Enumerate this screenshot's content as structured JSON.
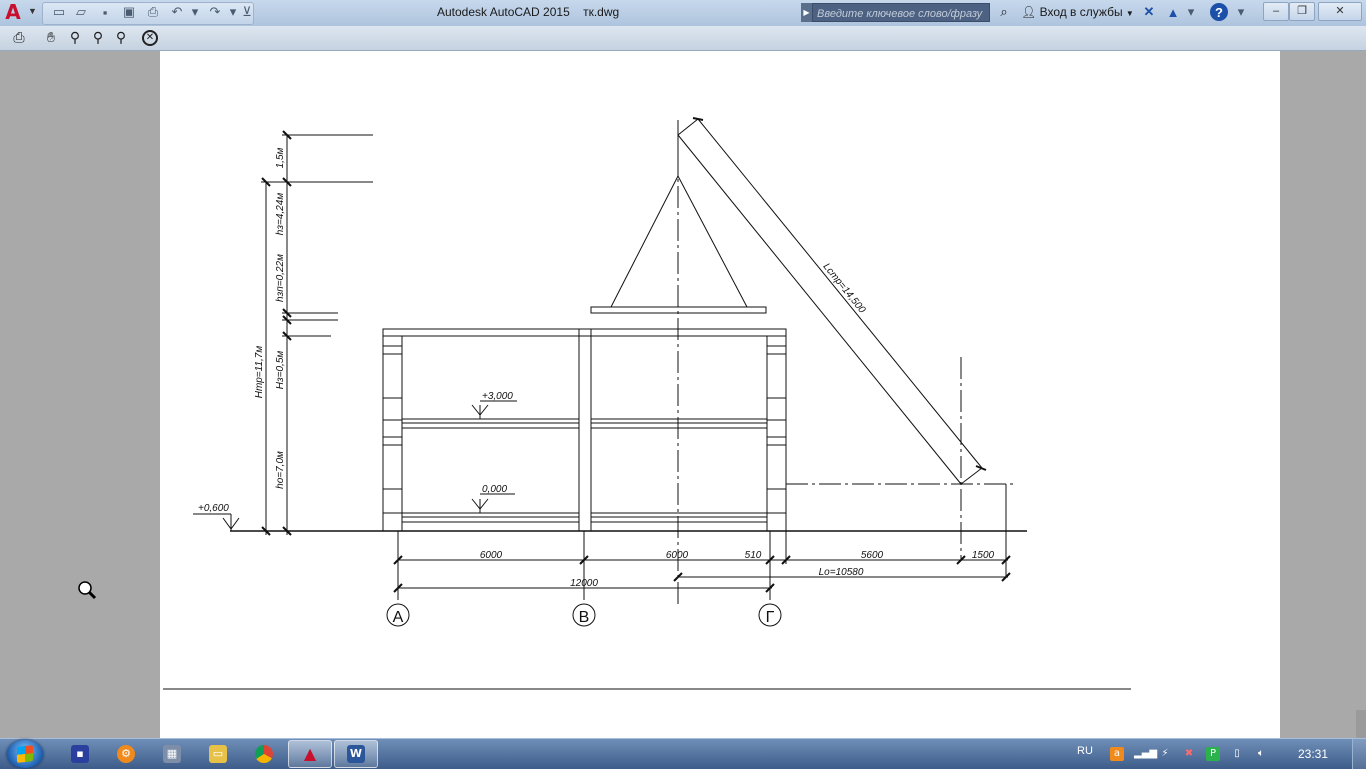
{
  "window": {
    "title": "Autodesk AutoCAD 2015    тк.dwg",
    "search_placeholder": "Введите ключевое слово/фразу",
    "login_label": "Вход в службы",
    "help_label": "?"
  },
  "quick_access": [
    "new-icon",
    "open-icon",
    "save-icon",
    "saveas-icon",
    "print-icon",
    "undo-icon",
    "redo-icon",
    "customize-icon"
  ],
  "preview_toolbar": [
    "print-icon",
    "pan-icon",
    "zoom-realtime-icon",
    "zoom-window-icon",
    "zoom-previous-icon",
    "close-preview-icon"
  ],
  "drawing": {
    "dims_left": [
      "1,5м",
      "hз=4,24м",
      "hзп=0,22м",
      "Hз=0,5м",
      "Hтр=11,7м",
      "hо=7,0м"
    ],
    "levels": [
      "+3,000",
      "0,000",
      "+0,600"
    ],
    "boom_label": "Lстр=14,500",
    "dims_bottom": [
      "6000",
      "6000",
      "510",
      "5600",
      "1500",
      "12000",
      "Lо=10580"
    ],
    "axes": [
      "А",
      "В",
      "Г"
    ]
  },
  "taskbar": {
    "apps": [
      "media-player-icon",
      "vlc-icon",
      "calculator-icon",
      "explorer-icon",
      "chrome-icon",
      "autocad-icon",
      "word-icon"
    ],
    "lang": "RU",
    "clock": "23:31"
  },
  "colors": {
    "autocad_red": "#c8102e",
    "taskbar": "#3d5c89",
    "title_bar": "#c7d8ec"
  }
}
